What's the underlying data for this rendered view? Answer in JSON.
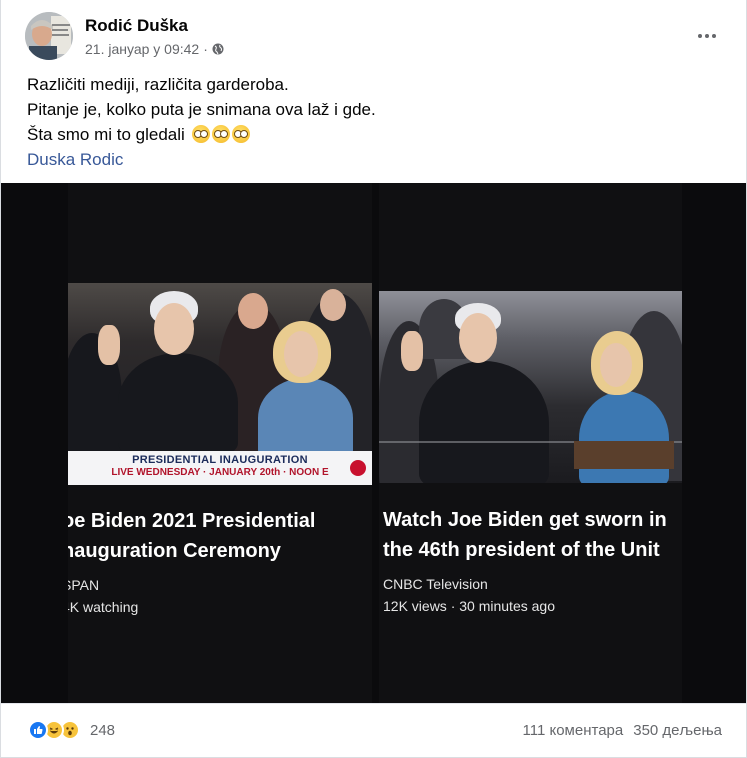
{
  "post": {
    "author": "Rodić Duška",
    "timestamp": "21. јануар у 09:42",
    "privacy_icon": "globe-icon",
    "text_lines": [
      "Različiti mediji, različita garderoba.",
      "Pitanje je, kolko puta je snimana ova laž i gde.",
      "Šta smo mi to gledali"
    ],
    "emojis": [
      "dizzy-face-emoji",
      "dizzy-face-emoji",
      "dizzy-face-emoji"
    ],
    "author_link": "Duska Rodic"
  },
  "photo": {
    "left": {
      "banner_line1": "PRESIDENTIAL INAUGURATION",
      "banner_line2": "LIVE WEDNESDAY · JANUARY 20th · NOON E",
      "title_line1": "oe Biden 2021 Presidential",
      "title_line2": "nauguration Ceremony",
      "channel": "SPAN",
      "views": "4K watching"
    },
    "right": {
      "title_line1": "Watch Joe Biden get sworn in",
      "title_line2": "the 46th president of the Unit",
      "channel": "CNBC Television",
      "views": "12K views · 30 minutes ago"
    }
  },
  "footer": {
    "reaction_icons": [
      "like-icon",
      "haha-icon",
      "wow-icon"
    ],
    "reaction_count": "248",
    "comments": "111 коментара",
    "shares": "350 дељења"
  },
  "colors": {
    "link": "#385898",
    "like": "#1877f2",
    "banner_red": "#b1142b",
    "banner_navy": "#1b2b5a"
  }
}
